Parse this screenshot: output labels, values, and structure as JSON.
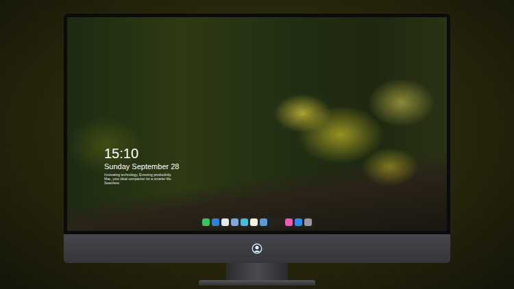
{
  "lock_screen": {
    "time": "15:10",
    "date": "Sunday September 28",
    "tagline": "Innovating technology, Ensuring productivity. Mac, your ideal companion for a smarter life. Seamless"
  },
  "dock": {
    "items": [
      {
        "color": "#34c759"
      },
      {
        "color": "#2f7fe0"
      },
      {
        "color": "#e8e8e8"
      },
      {
        "color": "#7fa8d8"
      },
      {
        "color": "#40c0d8"
      },
      {
        "color": "#f5f2e0"
      },
      {
        "color": "#5a9ad8"
      },
      {
        "gap": true,
        "color": "#000000"
      },
      {
        "color": "#f05ab0"
      },
      {
        "color": "#2a8cf0"
      },
      {
        "color": "#9a9aa0"
      }
    ]
  }
}
